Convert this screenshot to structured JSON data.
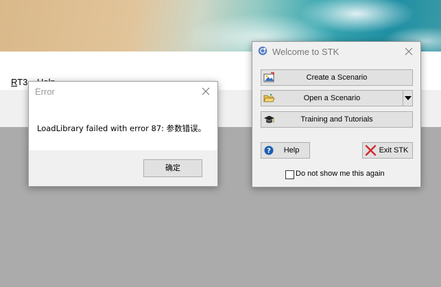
{
  "app_menu": {
    "items": [
      {
        "mnemonic": "R",
        "rest": "T3"
      },
      {
        "mnemonic": "",
        "rest": "Help"
      }
    ]
  },
  "error_dialog": {
    "title": "Error",
    "message": "LoadLibrary failed with error 87: 参数错误。",
    "ok_label": "确定"
  },
  "stk_dialog": {
    "title": "Welcome to STK",
    "create_label": "Create a Scenario",
    "open_label": "Open a Scenario",
    "training_label": "Training and Tutorials",
    "help_label": "Help",
    "exit_label": "Exit STK",
    "dont_show_label": "Do not show me this again",
    "dont_show_checked": false
  },
  "icons": {
    "create": "create-scenario-icon",
    "open": "open-folder-icon",
    "training": "graduation-cap-icon",
    "help": "help-icon",
    "exit": "red-x-icon"
  },
  "colors": {
    "help_blue": "#1c5fb0",
    "exit_red": "#d4282c",
    "desktop_gray": "#ababab"
  }
}
